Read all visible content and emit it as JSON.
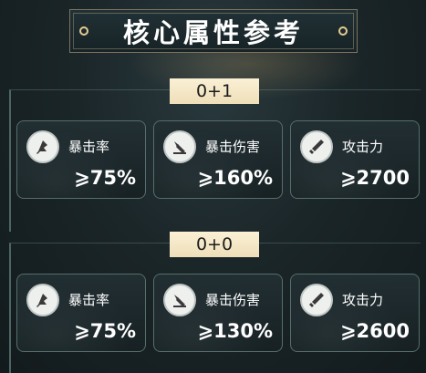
{
  "title": "核心属性参考",
  "sections": [
    {
      "badge": "0+1",
      "stats": [
        {
          "icon": "crit-rate-icon",
          "label": "暴击率",
          "value": "⩾75%"
        },
        {
          "icon": "crit-damage-icon",
          "label": "暴击伤害",
          "value": "⩾160%"
        },
        {
          "icon": "attack-icon",
          "label": "攻击力",
          "value": "⩾2700"
        }
      ]
    },
    {
      "badge": "0+0",
      "stats": [
        {
          "icon": "crit-rate-icon",
          "label": "暴击率",
          "value": "⩾75%"
        },
        {
          "icon": "crit-damage-icon",
          "label": "暴击伤害",
          "value": "⩾130%"
        },
        {
          "icon": "attack-icon",
          "label": "攻击力",
          "value": "⩾2600"
        }
      ]
    }
  ],
  "colors": {
    "badge_bg": "#f3e7c6",
    "accent_gold": "#e6cd93",
    "card_border": "#566e6c"
  }
}
